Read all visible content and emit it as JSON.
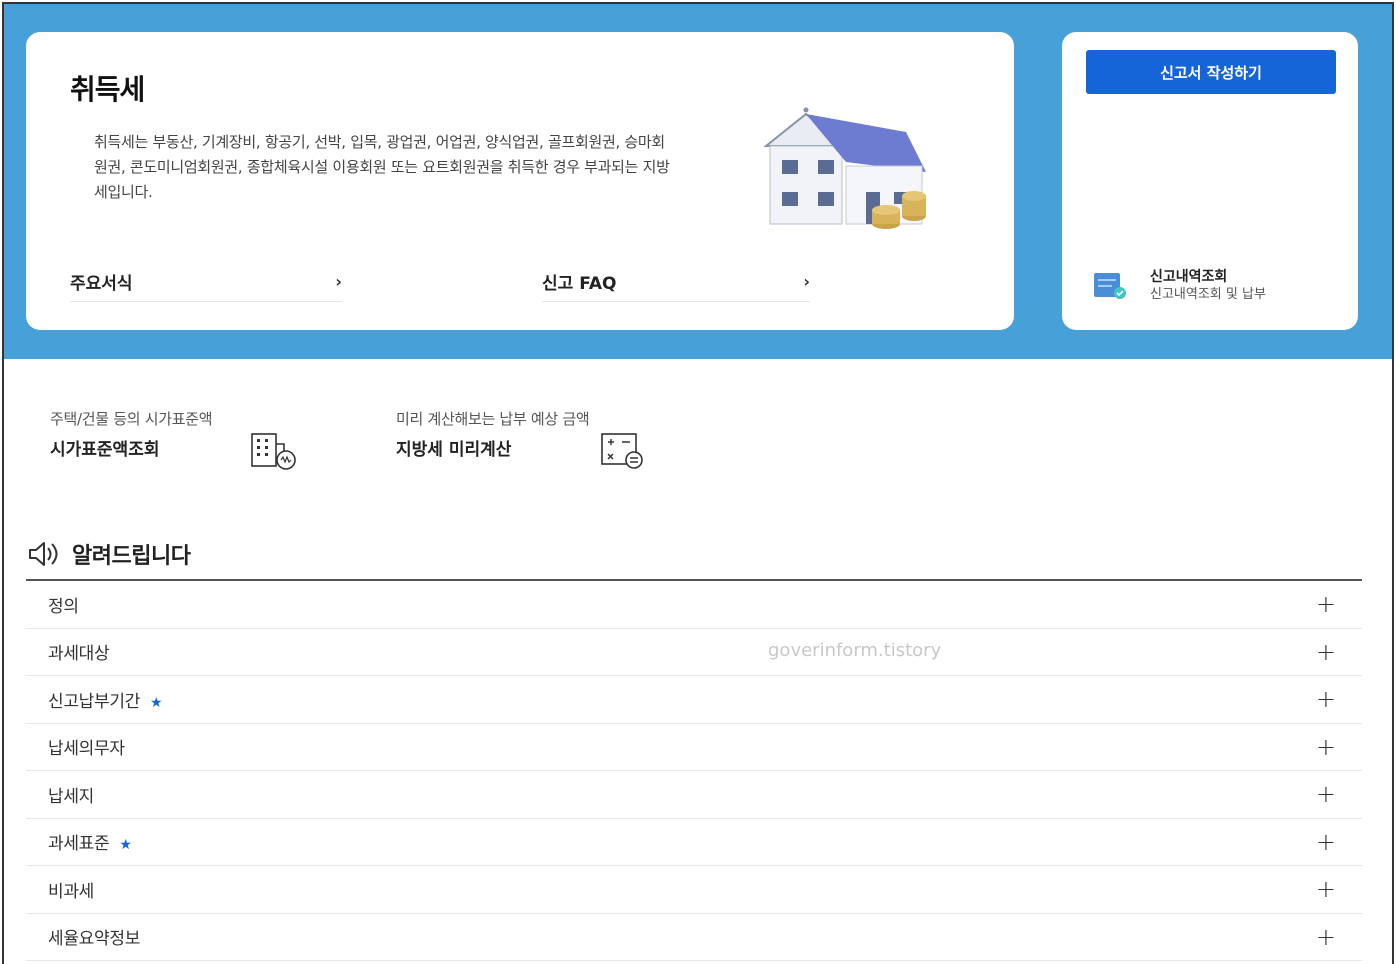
{
  "hero": {
    "title": "취득세",
    "description": "취득세는 부동산, 기계장비, 항공기, 선박, 입목, 광업권, 어업권, 양식업권, 골프회원권, 승마회원권, 콘도미니엄회원권, 종합체육시설 이용회원 또는 요트회원권을 취득한 경우 부과되는 지방세입니다.",
    "links": [
      {
        "label": "주요서식",
        "icon": "chevron-right-icon",
        "chevron": "›"
      },
      {
        "label": "신고 FAQ",
        "icon": "chevron-right-icon",
        "chevron": "›"
      }
    ],
    "illustration": "house-with-coins"
  },
  "side": {
    "write_button": "신고서 작성하기",
    "history_title": "신고내역조회",
    "history_sub": "신고내역조회 및 납부",
    "history_icon": "document-check-icon"
  },
  "quick": [
    {
      "sub": "주택/건물 등의 시가표준액",
      "main": "시가표준액조회",
      "icon": "building-calc-icon"
    },
    {
      "sub": "미리 계산해보는 납부 예상 금액",
      "main": "지방세 미리계산",
      "icon": "calculator-icon"
    }
  ],
  "notice": {
    "title": "알려드립니다",
    "icon": "speaker-icon",
    "items": [
      {
        "label": "정의",
        "star": ""
      },
      {
        "label": "과세대상",
        "star": ""
      },
      {
        "label": "신고납부기간",
        "star": "★"
      },
      {
        "label": "납세의무자",
        "star": ""
      },
      {
        "label": "납세지",
        "star": ""
      },
      {
        "label": "과세표준",
        "star": "★"
      },
      {
        "label": "비과세",
        "star": ""
      },
      {
        "label": "세율요약정보",
        "star": ""
      }
    ],
    "expand_symbol": "+"
  },
  "watermark": "goverinform.tistory",
  "colors": {
    "hero_bg": "#48a0d8",
    "primary": "#1565d8"
  }
}
